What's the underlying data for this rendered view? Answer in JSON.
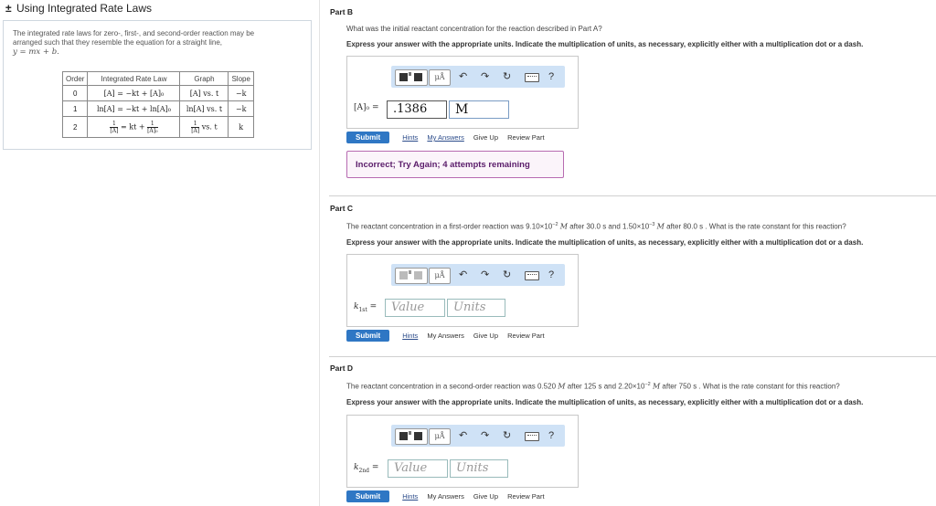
{
  "left": {
    "header_prefix": "±",
    "header_title": "Using Integrated Rate Laws",
    "intro_line1": "The integrated rate laws for zero-, first-, and second-order reaction may be",
    "intro_line2": "arranged such that they resemble the equation for a straight line,",
    "intro_line3": "y = mx + b.",
    "table": {
      "headers": [
        "Order",
        "Integrated Rate Law",
        "Graph",
        "Slope"
      ],
      "rows": [
        {
          "order": "0",
          "law": "[A] = −kt + [A]₀",
          "graph": "[A] vs. t",
          "slope": "−k"
        },
        {
          "order": "1",
          "law": "ln[A] = −kt + ln[A]₀",
          "graph": "ln[A] vs. t",
          "slope": "−k"
        },
        {
          "order": "2",
          "law_mid": "= kt +",
          "graph_suffix": "vs. t",
          "slope": "k",
          "one": "1",
          "a": "[A]",
          "a0": "[A]₀"
        }
      ]
    }
  },
  "express_text": "Express your answer with the appropriate units. Indicate the multiplication of units, as necessary, explicitly either with a multiplication dot or a dash.",
  "toolbar": {
    "mu_label": "μÅ",
    "undo": "↶",
    "redo": "↷",
    "reset": "↻",
    "help": "?"
  },
  "actions": {
    "submit": "Submit",
    "hints": "Hints",
    "my_answers": "My Answers",
    "give_up": "Give Up",
    "review": "Review Part"
  },
  "partB": {
    "title": "Part B",
    "question": "What was the initial reactant concentration for the reaction described in Part A?",
    "label": "[A]₀ =",
    "value": ".1386",
    "units": "M",
    "feedback": "Incorrect; Try Again; 4 attempts remaining"
  },
  "partC": {
    "title": "Part C",
    "q_pre": "The reactant concentration in a first-order reaction was 9.10×10",
    "q_exp1": "−2",
    "q_unit1": "M",
    "q_mid": "after 30.0 s and 1.50×10",
    "q_exp2": "−3",
    "q_unit2": "M",
    "q_post": "after 80.0 s . What is the rate constant for this reaction?",
    "label_k": "k",
    "label_sub": "1st",
    "label_eq": "=",
    "value_placeholder": "Value",
    "units_placeholder": "Units"
  },
  "partD": {
    "title": "Part D",
    "q_pre": "The reactant concentration in a second-order reaction was 0.520",
    "q_unit1": "M",
    "q_mid": "after 125 s and 2.20×10",
    "q_exp": "−2",
    "q_unit2": "M",
    "q_post": "after 750 s . What is the rate constant for this reaction?",
    "label_k": "k",
    "label_sub": "2nd",
    "label_eq": "=",
    "value_placeholder": "Value",
    "units_placeholder": "Units"
  }
}
